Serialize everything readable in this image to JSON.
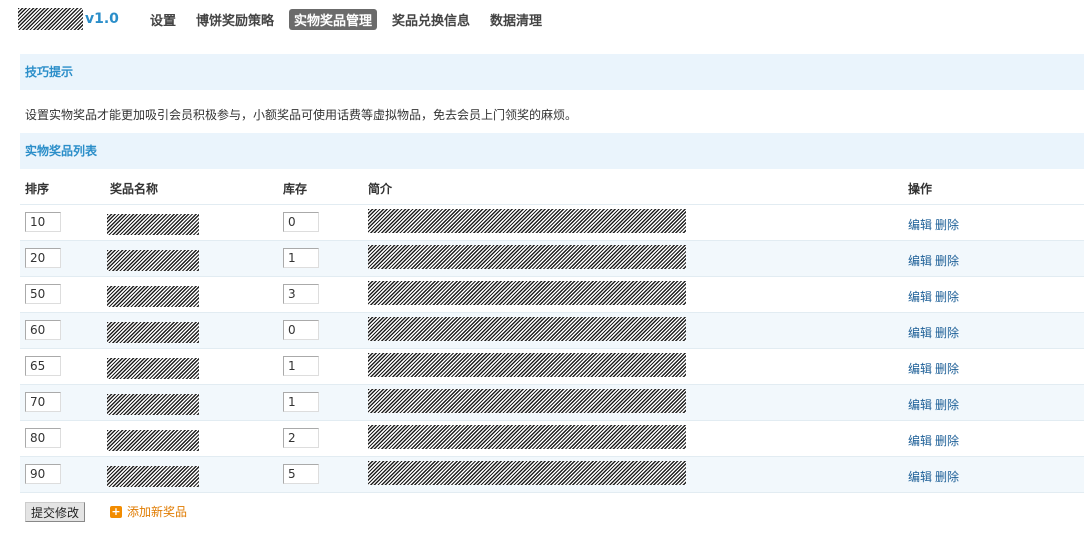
{
  "header": {
    "version": "v1.0",
    "nav": [
      "设置",
      "博饼奖励策略",
      "实物奖品管理",
      "奖品兑换信息",
      "数据清理"
    ],
    "active_index": 2
  },
  "tips": {
    "title": "技巧提示",
    "text": "设置实物奖品才能更加吸引会员积极参与，小额奖品可使用话费等虚拟物品，免去会员上门领奖的麻烦。"
  },
  "list": {
    "title": "实物奖品列表",
    "columns": {
      "order": "排序",
      "name": "奖品名称",
      "stock": "库存",
      "desc": "简介",
      "ops": "操作"
    },
    "edit_label": "编辑",
    "delete_label": "删除",
    "rows": [
      {
        "order": "10",
        "stock": "0"
      },
      {
        "order": "20",
        "stock": "1"
      },
      {
        "order": "50",
        "stock": "3"
      },
      {
        "order": "60",
        "stock": "0"
      },
      {
        "order": "65",
        "stock": "1"
      },
      {
        "order": "70",
        "stock": "1"
      },
      {
        "order": "80",
        "stock": "2"
      },
      {
        "order": "90",
        "stock": "5"
      }
    ]
  },
  "footer": {
    "submit_label": "提交修改",
    "add_label": "添加新奖品"
  },
  "colors": {
    "accent": "#2b8ec9",
    "section_bg": "#eaf4fc",
    "link": "#1d5f97",
    "add": "#e07b00",
    "nav_active_bg": "#6b6b6b"
  },
  "icons": {
    "add": "plus-square-icon"
  }
}
